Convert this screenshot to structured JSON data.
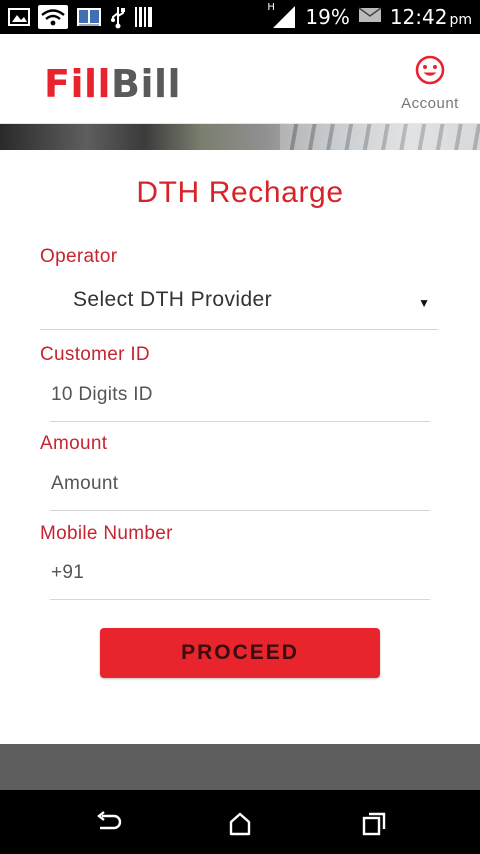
{
  "status_bar": {
    "battery": "19%",
    "time": "12:42",
    "ampm": "pm",
    "network_indicator": "H"
  },
  "header": {
    "logo_fill": "Fill",
    "logo_bill": "Bill",
    "account_label": "Account"
  },
  "form": {
    "title": "DTH Recharge",
    "operator_label": "Operator",
    "operator_value": "Select DTH Provider",
    "customer_id_label": "Customer ID",
    "customer_id_placeholder": "10 Digits ID",
    "amount_label": "Amount",
    "amount_placeholder": "Amount",
    "mobile_label": "Mobile Number",
    "mobile_value": "+91",
    "proceed_label": "PROCEED"
  },
  "colors": {
    "brand_red": "#e8232e",
    "label_red": "#c62430",
    "logo_gray": "#5a5a5a"
  },
  "icons": {
    "status": [
      "image-icon",
      "wifi-icon",
      "book-icon",
      "usb-icon",
      "barcode-icon",
      "signal-icon",
      "mail-icon"
    ],
    "account": "smiley-icon",
    "nav": [
      "back-icon",
      "home-icon",
      "recents-icon"
    ]
  }
}
